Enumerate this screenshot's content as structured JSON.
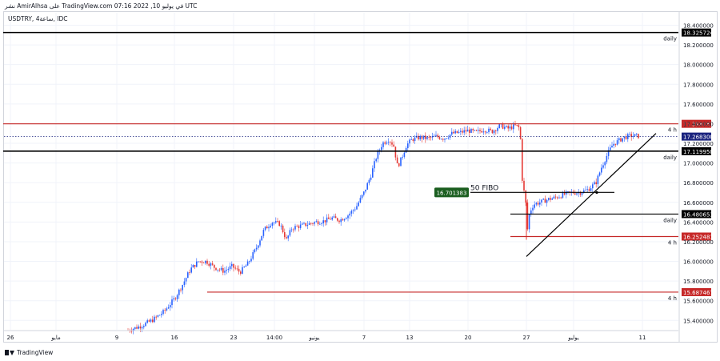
{
  "header": {
    "caption": "نشر AmirAlhsa على TradingView.com 07:16 2022 ,10 في يوليو UTC",
    "symbol": "USDTRY, 4ساعة, IDC",
    "brand": "TradingView"
  },
  "colors": {
    "up": "#2962ff",
    "down": "#e53935",
    "level_red": "#c62828",
    "level_black": "#000000",
    "fibo_box": "#1b5e20",
    "current_price": "#1a237e",
    "grid": "#f0f3fa"
  },
  "chart_data": {
    "type": "candlestick",
    "symbol": "USDTRY",
    "timeframe": "4ساعة",
    "ylim": [
      15.3,
      18.5
    ],
    "xlim": [
      0,
      900
    ],
    "y_ticks": [
      "18.400000",
      "18.200000",
      "18.000000",
      "17.800000",
      "17.600000",
      "17.400000",
      "17.200000",
      "17.000000",
      "16.800000",
      "16.600000",
      "16.400000",
      "16.200000",
      "16.000000",
      "15.800000",
      "15.600000",
      "15.400000"
    ],
    "x_ticks": [
      {
        "label": "26",
        "x": 13
      },
      {
        "label": "مايو",
        "x": 70
      },
      {
        "label": "9",
        "x": 146
      },
      {
        "label": "16",
        "x": 218
      },
      {
        "label": "23",
        "x": 292
      },
      {
        "label": "14:00",
        "x": 343
      },
      {
        "label": "يونيو",
        "x": 393
      },
      {
        "label": "7",
        "x": 455
      },
      {
        "label": "13",
        "x": 512
      },
      {
        "label": "20",
        "x": 585
      },
      {
        "label": "27",
        "x": 658
      },
      {
        "label": "يوليو",
        "x": 717
      },
      {
        "label": "11",
        "x": 803
      }
    ],
    "path": [
      [
        160,
        15.3
      ],
      [
        175,
        15.34
      ],
      [
        190,
        15.4
      ],
      [
        205,
        15.49
      ],
      [
        218,
        15.62
      ],
      [
        228,
        15.76
      ],
      [
        238,
        15.92
      ],
      [
        248,
        16.0
      ],
      [
        258,
        16.0
      ],
      [
        268,
        15.94
      ],
      [
        280,
        15.9
      ],
      [
        290,
        15.95
      ],
      [
        300,
        15.89
      ],
      [
        310,
        15.98
      ],
      [
        320,
        16.13
      ],
      [
        330,
        16.32
      ],
      [
        340,
        16.4
      ],
      [
        350,
        16.38
      ],
      [
        358,
        16.22
      ],
      [
        365,
        16.34
      ],
      [
        375,
        16.36
      ],
      [
        385,
        16.38
      ],
      [
        395,
        16.4
      ],
      [
        405,
        16.41
      ],
      [
        415,
        16.44
      ],
      [
        425,
        16.42
      ],
      [
        435,
        16.47
      ],
      [
        445,
        16.55
      ],
      [
        455,
        16.7
      ],
      [
        463,
        16.86
      ],
      [
        470,
        17.05
      ],
      [
        478,
        17.2
      ],
      [
        486,
        17.24
      ],
      [
        492,
        17.18
      ],
      [
        497,
        16.96
      ],
      [
        502,
        17.05
      ],
      [
        508,
        17.18
      ],
      [
        515,
        17.24
      ],
      [
        525,
        17.26
      ],
      [
        535,
        17.25
      ],
      [
        545,
        17.27
      ],
      [
        555,
        17.25
      ],
      [
        565,
        17.3
      ],
      [
        575,
        17.31
      ],
      [
        585,
        17.33
      ],
      [
        595,
        17.31
      ],
      [
        605,
        17.34
      ],
      [
        615,
        17.32
      ],
      [
        625,
        17.38
      ],
      [
        635,
        17.35
      ],
      [
        645,
        17.38
      ],
      [
        650,
        17.35
      ],
      [
        653,
        16.8
      ],
      [
        657,
        16.62
      ],
      [
        659,
        16.3
      ],
      [
        662,
        16.5
      ],
      [
        667,
        16.58
      ],
      [
        675,
        16.6
      ],
      [
        685,
        16.63
      ],
      [
        695,
        16.65
      ],
      [
        705,
        16.68
      ],
      [
        715,
        16.7
      ],
      [
        725,
        16.7
      ],
      [
        735,
        16.73
      ],
      [
        745,
        16.8
      ],
      [
        752,
        16.96
      ],
      [
        760,
        17.1
      ],
      [
        766,
        17.19
      ],
      [
        772,
        17.22
      ],
      [
        780,
        17.26
      ],
      [
        790,
        17.28
      ],
      [
        800,
        17.27
      ]
    ],
    "levels": [
      {
        "price": 18.325724,
        "label": "18.325724",
        "tag": "daily",
        "color": "#000000",
        "x_start": 4,
        "width": 1.6
      },
      {
        "price": 17.398061,
        "label": "17.398061",
        "tag": "4 h",
        "color": "#c62828",
        "x_start": 4,
        "width": 1.2
      },
      {
        "price": 17.119958,
        "label": "17.119958",
        "tag": "daily",
        "color": "#000000",
        "x_start": 4,
        "width": 1.6
      },
      {
        "price": 16.480653,
        "label": "16.480653",
        "tag": "daily",
        "color": "#000000",
        "x_start": 638,
        "width": 1.2
      },
      {
        "price": 16.252481,
        "label": "16.252481",
        "tag": "4 h",
        "color": "#c62828",
        "x_start": 638,
        "width": 1.2
      },
      {
        "price": 15.687467,
        "label": "15.687467",
        "tag": "4 h",
        "color": "#c62828",
        "x_start": 259,
        "width": 1.2
      }
    ],
    "current_price": {
      "price": 17.2683,
      "label": "17.268300"
    },
    "fibo": {
      "price": 16.701383,
      "label": "16.701383",
      "text": "50 FIBO",
      "x_start": 588,
      "x_end": 768
    },
    "trendline": {
      "start": [
        658,
        16.05
      ],
      "end": [
        820,
        17.3
      ]
    }
  }
}
